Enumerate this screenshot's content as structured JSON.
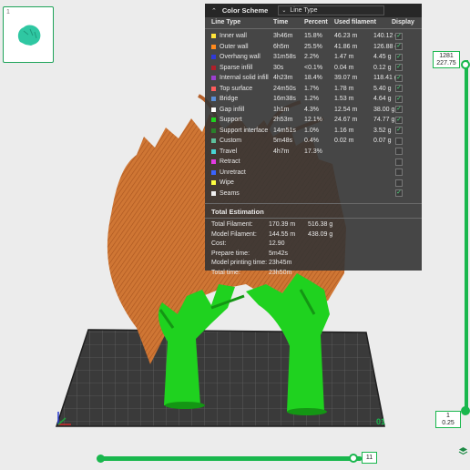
{
  "plate": {
    "index": "1"
  },
  "legend": {
    "title": "Color Scheme",
    "scheme": "Line Type",
    "columns": [
      "Line Type",
      "Time",
      "Percent",
      "Used filament",
      "Display"
    ],
    "rows": [
      {
        "name": "Inner wall",
        "time": "3h46m",
        "percent": "15.8%",
        "length": "46.23 m",
        "weight": "140.12 g",
        "display": true,
        "color": "#ffe53b"
      },
      {
        "name": "Outer wall",
        "time": "6h5m",
        "percent": "25.5%",
        "length": "41.86 m",
        "weight": "126.88 g",
        "display": true,
        "color": "#ff8a1c"
      },
      {
        "name": "Overhang wall",
        "time": "31m58s",
        "percent": "2.2%",
        "length": "1.47 m",
        "weight": "4.45 g",
        "display": true,
        "color": "#2f3ad8"
      },
      {
        "name": "Sparse infill",
        "time": "30s",
        "percent": "<0.1%",
        "length": "0.04 m",
        "weight": "0.12 g",
        "display": true,
        "color": "#b0202a"
      },
      {
        "name": "Internal solid infill",
        "time": "4h23m",
        "percent": "18.4%",
        "length": "39.07 m",
        "weight": "118.41 g",
        "display": true,
        "color": "#9c3fd0"
      },
      {
        "name": "Top surface",
        "time": "24m50s",
        "percent": "1.7%",
        "length": "1.78 m",
        "weight": "5.40 g",
        "display": true,
        "color": "#ff5c5c"
      },
      {
        "name": "Bridge",
        "time": "16m38s",
        "percent": "1.2%",
        "length": "1.53 m",
        "weight": "4.64 g",
        "display": true,
        "color": "#5b8ed6"
      },
      {
        "name": "Gap infill",
        "time": "1h1m",
        "percent": "4.3%",
        "length": "12.54 m",
        "weight": "38.00 g",
        "display": true,
        "color": "#ffffff"
      },
      {
        "name": "Support",
        "time": "2h53m",
        "percent": "12.1%",
        "length": "24.67 m",
        "weight": "74.77 g",
        "display": true,
        "color": "#1fd21f"
      },
      {
        "name": "Support interface",
        "time": "14m51s",
        "percent": "1.0%",
        "length": "1.16 m",
        "weight": "3.52 g",
        "display": true,
        "color": "#2a7f2a"
      },
      {
        "name": "Custom",
        "time": "5m48s",
        "percent": "0.4%",
        "length": "0.02 m",
        "weight": "0.07 g",
        "display": false,
        "color": "#5ec09c"
      },
      {
        "name": "Travel",
        "time": "4h7m",
        "percent": "17.3%",
        "length": "",
        "weight": "",
        "display": false,
        "color": "#48d6d6"
      },
      {
        "name": "Retract",
        "time": "",
        "percent": "",
        "length": "",
        "weight": "",
        "display": false,
        "color": "#e33be3"
      },
      {
        "name": "Unretract",
        "time": "",
        "percent": "",
        "length": "",
        "weight": "",
        "display": false,
        "color": "#3a64ff"
      },
      {
        "name": "Wipe",
        "time": "",
        "percent": "",
        "length": "",
        "weight": "",
        "display": false,
        "color": "#ffff40"
      },
      {
        "name": "Seams",
        "time": "",
        "percent": "",
        "length": "",
        "weight": "",
        "display": true,
        "color": "#f0f0f0"
      }
    ],
    "total_title": "Total Estimation",
    "totals": [
      {
        "label": "Total Filament:",
        "v1": "170.39 m",
        "v2": "516.38 g"
      },
      {
        "label": "Model Filament:",
        "v1": "144.55 m",
        "v2": "438.09 g"
      },
      {
        "label": "Cost:",
        "v1": "12.90",
        "v2": ""
      },
      {
        "label": "Prepare time:",
        "v1": "5m42s",
        "v2": ""
      },
      {
        "label": "Model printing time:",
        "v1": "23h45m",
        "v2": ""
      },
      {
        "label": "Total time:",
        "v1": "23h50m",
        "v2": ""
      }
    ]
  },
  "layer_slider": {
    "top_layer": "1281",
    "top_height": "227.75",
    "bottom_layer": "1",
    "bottom_height": "0.25"
  },
  "move_slider": {
    "value": "11"
  },
  "plate_label": "01",
  "colors": {
    "accent": "#19b74d",
    "support": "#1fd21f",
    "model": "#d47838"
  }
}
